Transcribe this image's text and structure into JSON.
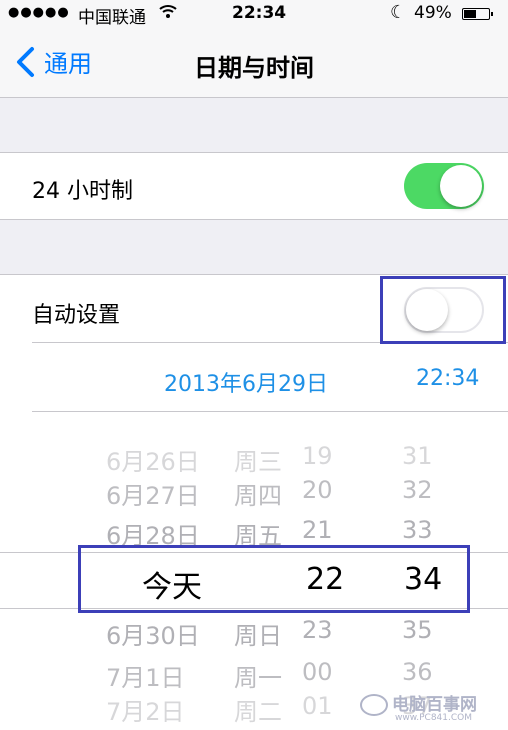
{
  "status_bar": {
    "signal": "●●●●●",
    "carrier": "中国联通",
    "wifi": "wifi-icon",
    "time": "22:34",
    "moon": "moon-icon",
    "battery_percent": "49%",
    "battery_level": 0.49
  },
  "nav": {
    "back_label": "通用",
    "title": "日期与时间"
  },
  "settings": {
    "hour24_label": "24 小时制",
    "hour24_on": true,
    "auto_set_label": "自动设置",
    "auto_set_on": false,
    "date_value": "2013年6月29日",
    "time_value": "22:34"
  },
  "picker": {
    "rows": [
      {
        "date": "6月26日",
        "weekday": "周三",
        "hour": "19",
        "minute": "31"
      },
      {
        "date": "6月27日",
        "weekday": "周四",
        "hour": "20",
        "minute": "32"
      },
      {
        "date": "6月28日",
        "weekday": "周五",
        "hour": "21",
        "minute": "33"
      },
      {
        "date": "今天",
        "weekday": "",
        "hour": "22",
        "minute": "34"
      },
      {
        "date": "6月30日",
        "weekday": "周日",
        "hour": "23",
        "minute": "35"
      },
      {
        "date": "7月1日",
        "weekday": "周一",
        "hour": "00",
        "minute": "36"
      },
      {
        "date": "7月2日",
        "weekday": "周二",
        "hour": "01",
        "minute": "37"
      }
    ]
  },
  "watermark": {
    "name": "电脑百事网",
    "url": "www.PC841.COM"
  }
}
